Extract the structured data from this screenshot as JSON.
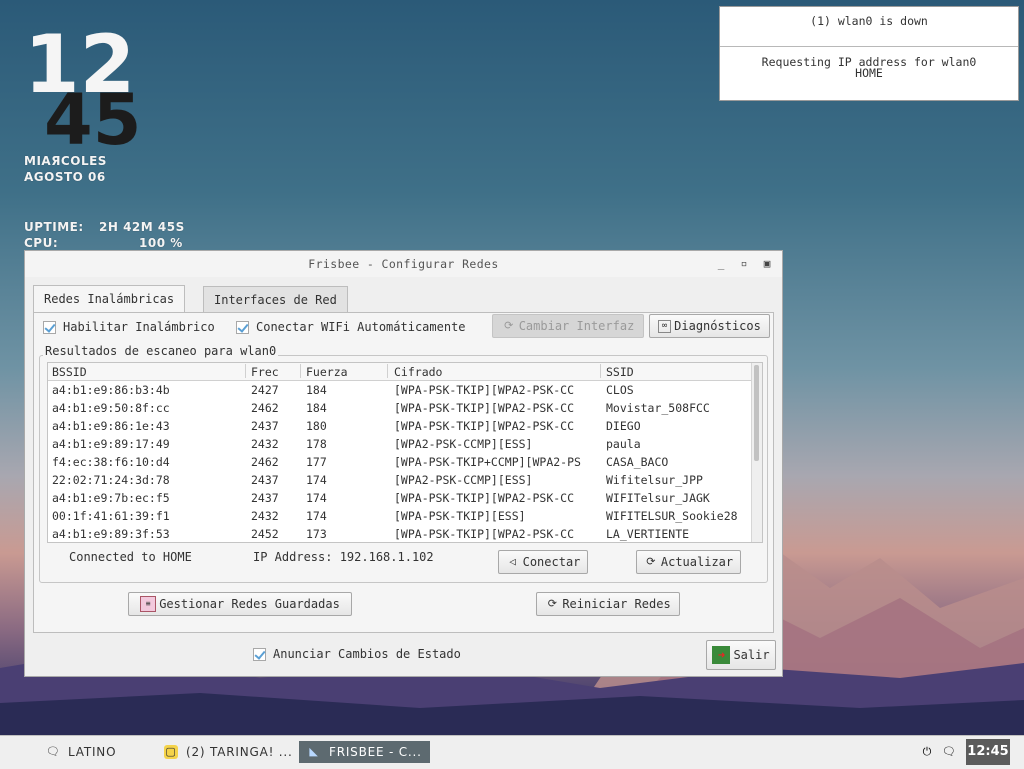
{
  "conky": {
    "time_hours": "12",
    "time_minutes": "45",
    "day": "MIAЯCOLES",
    "date": "AGOSTO 06",
    "uptime_label": "UPTIME:",
    "uptime_value": "2H 42M 45S",
    "cpu_label": "CPU:",
    "cpu_value": "100 %"
  },
  "notification": {
    "line1": "(1) wlan0 is down",
    "line2": "Requesting IP address for wlan0",
    "line3": "HOME"
  },
  "window": {
    "title": "Frisbee - Configurar Redes",
    "tabs": [
      {
        "label": "Redes Inalámbricas"
      },
      {
        "label": "Interfaces de Red"
      }
    ],
    "enable_wireless": "Habilitar Inalámbrico",
    "auto_connect": "Conectar WIFi Automáticamente",
    "change_interface": "Cambiar Interfaz",
    "diagnostics": "Diagnósticos",
    "scan_group_label": "Resultados de escaneo para wlan0",
    "columns": [
      "BSSID",
      "Frec",
      "Fuerza",
      "Cifrado",
      "SSID"
    ],
    "rows": [
      [
        "a4:b1:e9:86:b3:4b",
        "2427",
        "184",
        "[WPA-PSK-TKIP][WPA2-PSK-CC",
        "CLOS"
      ],
      [
        "a4:b1:e9:50:8f:cc",
        "2462",
        "184",
        "[WPA-PSK-TKIP][WPA2-PSK-CC",
        "Movistar_508FCC"
      ],
      [
        "a4:b1:e9:86:1e:43",
        "2437",
        "180",
        "[WPA-PSK-TKIP][WPA2-PSK-CC",
        "DIEGO"
      ],
      [
        "a4:b1:e9:89:17:49",
        "2432",
        "178",
        "[WPA2-PSK-CCMP][ESS]",
        "paula"
      ],
      [
        "f4:ec:38:f6:10:d4",
        "2462",
        "177",
        "[WPA-PSK-TKIP+CCMP][WPA2-PS",
        "CASA_BACO"
      ],
      [
        "22:02:71:24:3d:78",
        "2437",
        "174",
        "[WPA2-PSK-CCMP][ESS]",
        "Wifitelsur_JPP"
      ],
      [
        "a4:b1:e9:7b:ec:f5",
        "2437",
        "174",
        "[WPA-PSK-TKIP][WPA2-PSK-CC",
        "WIFITelsur_JAGK"
      ],
      [
        "00:1f:41:61:39:f1",
        "2432",
        "174",
        "[WPA-PSK-TKIP][ESS]",
        "WIFITELSUR_Sookie28"
      ],
      [
        "a4:b1:e9:89:3f:53",
        "2452",
        "173",
        "[WPA-PSK-TKIP][WPA2-PSK-CC",
        "LA_VERTIENTE"
      ]
    ],
    "status_connected": "Connected to HOME",
    "status_ip": "IP Address: 192.168.1.102",
    "connect": "Conectar",
    "refresh": "Actualizar",
    "manage_saved": "Gestionar Redes Guardadas",
    "restart_networks": "Reiniciar Redes",
    "announce_changes": "Anunciar Cambios de Estado",
    "exit": "Salir"
  },
  "taskbar": {
    "tasks": [
      {
        "label": "LATINO"
      },
      {
        "label": "(2) TARINGA! ..."
      },
      {
        "label": "FRISBEE - C..."
      }
    ],
    "clock": "12:45"
  }
}
